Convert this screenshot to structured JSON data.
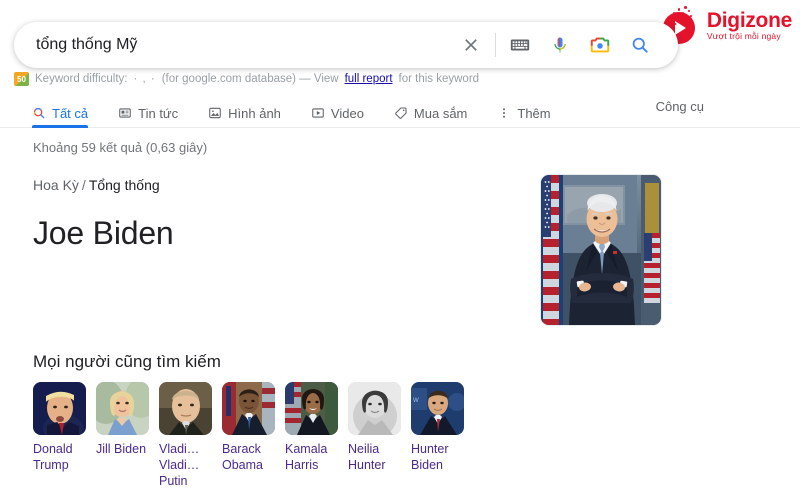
{
  "brand": {
    "name": "Digizone",
    "tagline": "Vượt trội mỗi ngày",
    "color": "#e4122b"
  },
  "search": {
    "value": "tổng thống Mỹ",
    "placeholder": "Tìm kiếm trên Google",
    "icons": [
      "close-icon",
      "keyboard-icon",
      "microphone-icon",
      "camera-lens-icon",
      "search-icon"
    ]
  },
  "keyword_tool": {
    "badge": "50",
    "prefix": "Keyword difficulty:",
    "dots": "· , ·",
    "database": "(for google.com database) — View",
    "link": "full report",
    "suffix": "for this keyword"
  },
  "tabs": [
    {
      "label": "Tất cả",
      "icon": "search-icon",
      "active": true
    },
    {
      "label": "Tin tức",
      "icon": "news-icon",
      "active": false
    },
    {
      "label": "Hình ảnh",
      "icon": "image-icon",
      "active": false
    },
    {
      "label": "Video",
      "icon": "video-icon",
      "active": false
    },
    {
      "label": "Mua sắm",
      "icon": "tag-icon",
      "active": false
    },
    {
      "label": "Thêm",
      "icon": "more-vertical-icon",
      "active": false
    }
  ],
  "tools_label": "Công cụ",
  "results": {
    "count_text": "Khoảng 59 kết quả (0,63 giây)",
    "breadcrumb_parent": "Hoa Kỳ",
    "breadcrumb_separator": "/",
    "breadcrumb_current": "Tổng thống",
    "title": "Joe Biden",
    "hero_alt": "Joe Biden portrait"
  },
  "people_also_search": {
    "heading": "Mọi người cũng tìm kiếm",
    "items": [
      {
        "name": "Donald Trump"
      },
      {
        "name": "Jill Biden"
      },
      {
        "name": "Vladi… Vladi… Putin"
      },
      {
        "name": "Barack Obama"
      },
      {
        "name": "Kamala Harris"
      },
      {
        "name": "Neilia Hunter"
      },
      {
        "name": "Hunter Biden"
      }
    ]
  },
  "colors": {
    "google_blue": "#1a73e8",
    "link_purple": "#4b2a8c",
    "link_blue": "#1a0dab",
    "text_primary": "#202124",
    "text_secondary": "#70757a"
  }
}
